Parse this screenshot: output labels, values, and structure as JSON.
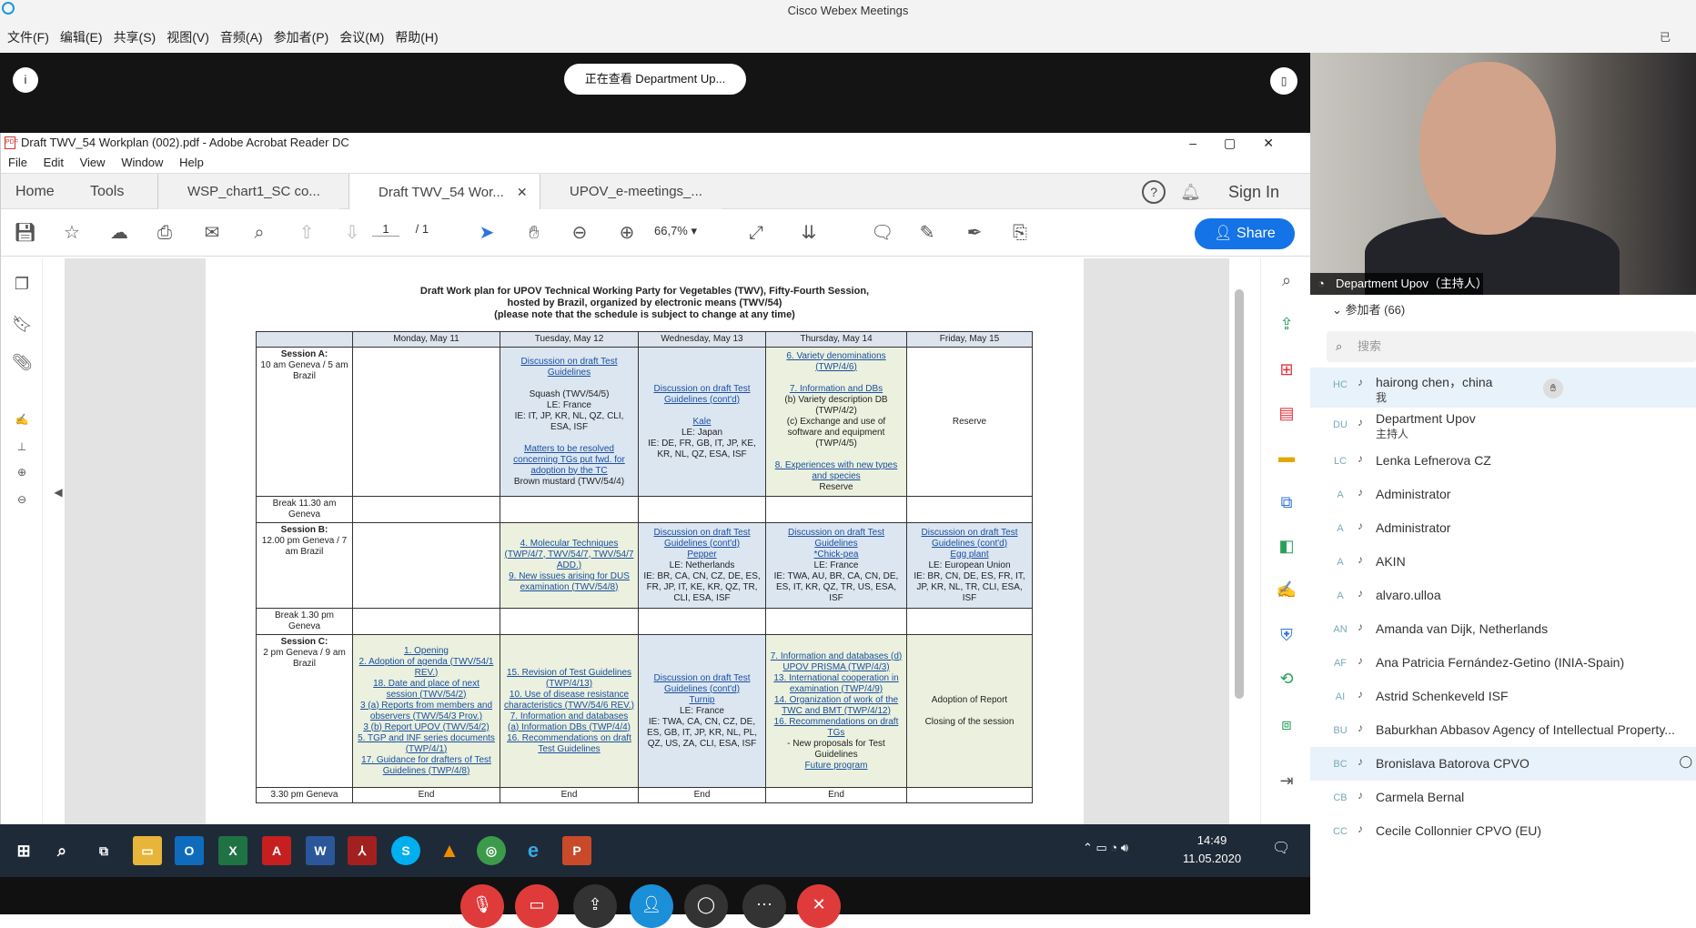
{
  "webex": {
    "window_title": "Cisco Webex Meetings",
    "menu": [
      "文件(F)",
      "编辑(E)",
      "共享(S)",
      "视图(V)",
      "音频(A)",
      "参加者(P)",
      "会议(M)",
      "帮助(H)"
    ],
    "rec_label": "已",
    "viewing_label": "正在查看 Department Up...",
    "info_icon": "i"
  },
  "acrobat": {
    "title": "Draft TWV_54 Workplan (002).pdf - Adobe Acrobat Reader DC",
    "menu": [
      "File",
      "Edit",
      "View",
      "Window",
      "Help"
    ],
    "tabs": {
      "home": "Home",
      "tools": "Tools",
      "doc1": "WSP_chart1_SC co...",
      "doc2": "Draft TWV_54 Wor...",
      "doc3": "UPOV_e-meetings_..."
    },
    "sign_in": "Sign In",
    "page_current": "1",
    "page_total": "/ 1",
    "zoom": "66,7%",
    "share": "Share"
  },
  "document": {
    "heading1": "Draft Work plan for UPOV Technical Working Party for Vegetables (TWV), Fifty-Fourth Session,",
    "heading2": "hosted by Brazil, organized by electronic means (TWV/54)",
    "heading3": "(please note that the schedule is subject to change at any time)",
    "days": [
      "Monday, May 11",
      "Tuesday, May 12",
      "Wednesday, May 13",
      "Thursday, May 14",
      "Friday, May 15"
    ],
    "session_a": {
      "label": "Session A:",
      "time": "10 am Geneva / 5 am Brazil",
      "tue": [
        "Discussion on draft Test Guidelines",
        "Squash (TWV/54/5)",
        "LE: France",
        "IE: IT, JP, KR, NL, QZ, CLI, ESA, ISF",
        "Matters to be resolved concerning TGs put fwd. for adoption by the TC",
        "Brown mustard (TWV/54/4)"
      ],
      "wed": [
        "Discussion on draft Test Guidelines (cont'd)",
        "Kale",
        "LE: Japan",
        "IE: DE, FR, GB, IT, JP, KE, KR, NL, QZ, ESA, ISF"
      ],
      "thu": [
        "6. Variety denominations (TWP/4/6)",
        "7. Information and DBs",
        "(b) Variety description DB (TWP/4/2)",
        "(c) Exchange and use of software and equipment (TWP/4/5)",
        "8. Experiences with new types and species",
        "Reserve"
      ],
      "fri": "Reserve"
    },
    "break1": "Break 11.30 am Geneva",
    "session_b": {
      "label": "Session B:",
      "time": "12.00 pm Geneva / 7 am Brazil",
      "tue": [
        "4. Molecular Techniques (TWP/4/7, TWV/54/7, TWV/54/7 ADD.)",
        "9. New issues arising for DUS examination (TWV/54/8)"
      ],
      "wed": [
        "Discussion on draft Test Guidelines (cont'd)",
        "Pepper",
        "LE: Netherlands",
        "IE: BR, CA, CN, CZ, DE, ES, FR, JP, IT, KE, KR, QZ, TR, CLI, ESA, ISF"
      ],
      "thu": [
        "Discussion on draft Test Guidelines",
        "*Chick-pea",
        "LE: France",
        "IE: TWA, AU, BR, CA, CN, DE, ES, IT, KR, QZ, TR, US, ESA, ISF"
      ],
      "fri": [
        "Discussion on draft Test Guidelines (cont'd)",
        "Egg plant",
        "LE: European Union",
        "IE: BR, CN, DE, ES, FR, IT, JP, KR, NL, TR, CLI, ESA, ISF"
      ]
    },
    "break2": "Break 1.30 pm Geneva",
    "session_c": {
      "label": "Session C:",
      "time": "2 pm Geneva / 9 am Brazil",
      "mon": [
        "1. Opening",
        "2. Adoption of agenda (TWV/54/1 REV.)",
        "18. Date and place of next session (TWV/54/2)",
        "3 (a) Reports from members and observers (TWV/54/3 Prov.)",
        "3 (b) Report UPOV (TWV/54/2)",
        "5. TGP and INF series documents (TWP/4/1)",
        "17. Guidance for drafters of Test Guidelines (TWP/4/8)"
      ],
      "tue": [
        "15. Revision of Test Guidelines (TWP/4/13)",
        "10. Use of disease resistance characteristics (TWV/54/6 REV.)",
        "7. Information and databases (a) Information DBs (TWP/4/4)",
        "16. Recommendations on draft Test Guidelines"
      ],
      "wed": [
        "Discussion on draft Test Guidelines (cont'd)",
        "Turnip",
        "LE: France",
        "IE: TWA, CA, CN, CZ, DE, ES, GB, IT, JP, KR, NL, PL, QZ, US, ZA, CLI, ESA, ISF"
      ],
      "thu": [
        "7. Information and databases (d) UPOV PRISMA (TWP/4/3)",
        "13. International cooperation in examination (TWP/4/9)",
        "14. Organization of work of the TWC and BMT (TWP/4/12)",
        "16. Recommendations on draft TGs",
        "- New proposals for Test Guidelines",
        "Future program"
      ],
      "fri": [
        "Adoption of Report",
        "Closing of the session"
      ]
    },
    "end_row": {
      "time": "3.30 pm Geneva",
      "end": "End"
    }
  },
  "taskbar": {
    "time": "14:49",
    "date": "11.05.2020"
  },
  "video": {
    "name": "Department Upov（主持人）"
  },
  "participants": {
    "header": "参加者 (66)",
    "search_placeholder": "搜索",
    "list": [
      {
        "initials": "HC",
        "name": "hairong chen，china",
        "sub": "我"
      },
      {
        "initials": "DU",
        "name": "Department Upov",
        "sub": "主持人"
      },
      {
        "initials": "LC",
        "name": "Lenka Lefnerova CZ",
        "sub": ""
      },
      {
        "initials": "A",
        "name": "Administrator",
        "sub": ""
      },
      {
        "initials": "A",
        "name": "Administrator",
        "sub": ""
      },
      {
        "initials": "A",
        "name": "AKIN",
        "sub": ""
      },
      {
        "initials": "A",
        "name": "alvaro.ulloa",
        "sub": ""
      },
      {
        "initials": "AN",
        "name": "Amanda van Dijk, Netherlands",
        "sub": ""
      },
      {
        "initials": "AF",
        "name": "Ana Patricia Fernández-Getino (INIA-Spain)",
        "sub": ""
      },
      {
        "initials": "AI",
        "name": "Astrid Schenkeveld ISF",
        "sub": ""
      },
      {
        "initials": "BU",
        "name": "Baburkhan Abbasov Agency of Intellectual Property...",
        "sub": ""
      },
      {
        "initials": "BC",
        "name": "Bronislava Batorova CPVO",
        "sub": ""
      },
      {
        "initials": "CB",
        "name": "Carmela Bernal",
        "sub": ""
      },
      {
        "initials": "CC",
        "name": "Cecile Collonnier CPVO (EU)",
        "sub": ""
      }
    ]
  }
}
